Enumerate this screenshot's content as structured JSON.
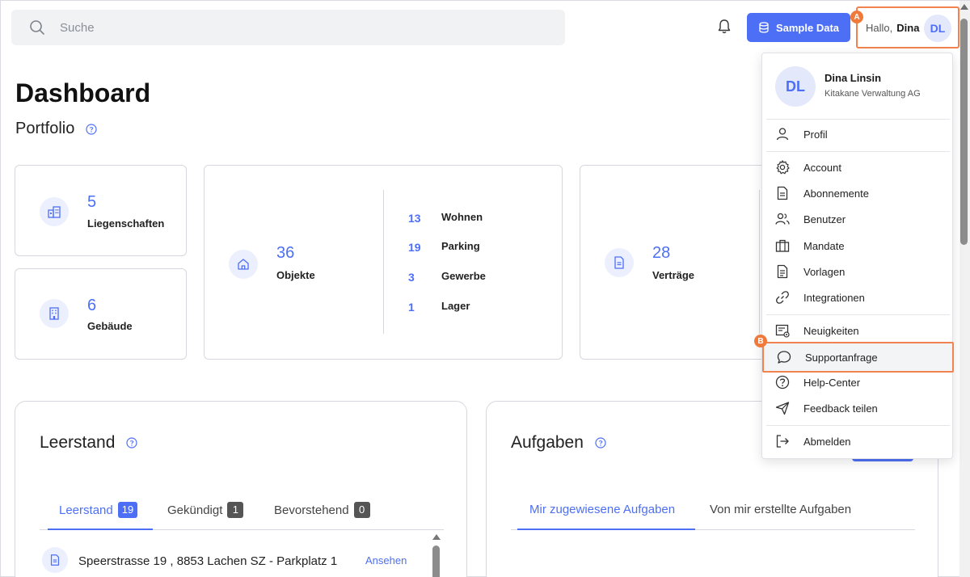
{
  "header": {
    "search_placeholder": "Suche",
    "sample_data_label": "Sample Data",
    "greeting": "Hallo,",
    "user_first_name": "Dina",
    "avatar_initials": "DL",
    "marker_a": "A",
    "marker_b": "B"
  },
  "dashboard": {
    "title": "Dashboard",
    "portfolio_label": "Portfolio"
  },
  "stats": {
    "liegenschaften": {
      "value": "5",
      "label": "Liegenschaften"
    },
    "gebaeude": {
      "value": "6",
      "label": "Gebäude"
    },
    "objekte": {
      "value": "36",
      "label": "Objekte"
    },
    "objekte_breakdown": [
      {
        "value": "13",
        "label": "Wohnen"
      },
      {
        "value": "19",
        "label": "Parking"
      },
      {
        "value": "3",
        "label": "Gewerbe"
      },
      {
        "value": "1",
        "label": "Lager"
      }
    ],
    "vertraege": {
      "value": "28",
      "label": "Verträge"
    }
  },
  "leerstand": {
    "title": "Leerstand",
    "tabs": [
      {
        "label": "Leerstand",
        "count": "19"
      },
      {
        "label": "Gekündigt",
        "count": "1"
      },
      {
        "label": "Bevorstehend",
        "count": "0"
      }
    ],
    "rows": [
      {
        "address": "Speerstrasse 19 , 8853 Lachen SZ - Parkplatz 1",
        "action": "Ansehen"
      }
    ]
  },
  "aufgaben": {
    "title": "Aufgaben",
    "tabs": [
      {
        "label": "Mir zugewiesene Aufgaben"
      },
      {
        "label": "Von mir erstellte Aufgaben"
      }
    ]
  },
  "user_menu": {
    "avatar_initials": "DL",
    "full_name": "Dina Linsin",
    "company": "Kitakane Verwaltung AG",
    "items": [
      {
        "label": "Profil",
        "icon": "user-icon"
      },
      {
        "label": "Account",
        "icon": "gear-icon"
      },
      {
        "label": "Abonnemente",
        "icon": "document-icon"
      },
      {
        "label": "Benutzer",
        "icon": "users-icon"
      },
      {
        "label": "Mandate",
        "icon": "briefcase-icon"
      },
      {
        "label": "Vorlagen",
        "icon": "template-icon"
      },
      {
        "label": "Integrationen",
        "icon": "link-icon"
      },
      {
        "label": "Neuigkeiten",
        "icon": "news-icon"
      },
      {
        "label": "Supportanfrage",
        "icon": "chat-icon"
      },
      {
        "label": "Help-Center",
        "icon": "help-icon"
      },
      {
        "label": "Feedback teilen",
        "icon": "send-icon"
      },
      {
        "label": "Abmelden",
        "icon": "logout-icon"
      }
    ]
  },
  "colors": {
    "accent": "#4d6ff5",
    "highlight": "#f0834f"
  }
}
